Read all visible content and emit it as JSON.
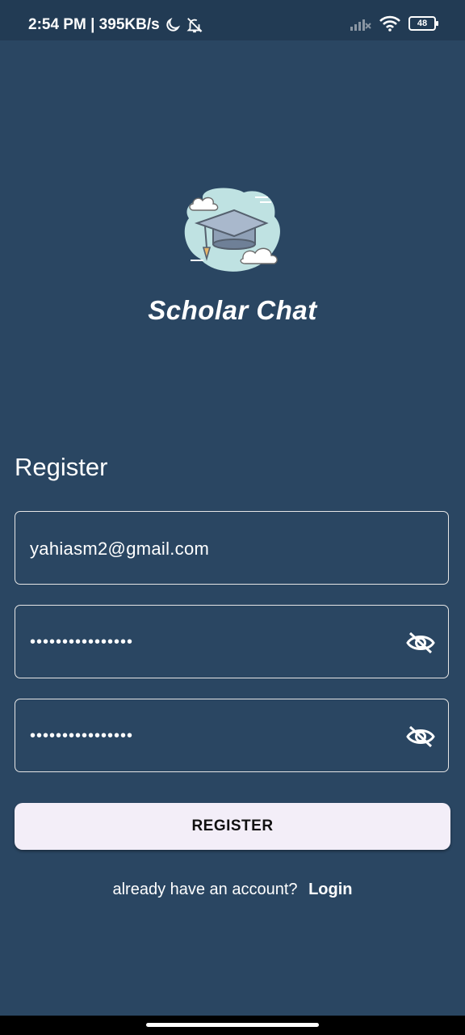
{
  "status_bar": {
    "time_speed": "2:54 PM | 395KB/s",
    "battery": "48"
  },
  "app": {
    "title": "Scholar Chat"
  },
  "form": {
    "heading": "Register",
    "email_value": "yahiasm2@gmail.com",
    "password_value": "••••••••••••••••",
    "confirm_password_value": "••••••••••••••••",
    "register_label": "REGISTER"
  },
  "footer": {
    "prompt": "already have an account?",
    "login_label": "Login"
  },
  "colors": {
    "background": "#2a4662",
    "status_bar": "#223b54",
    "button_bg": "#f3eef8"
  },
  "icons": [
    "moon-icon",
    "bell-off-icon",
    "signal-icon",
    "wifi-icon",
    "battery-icon",
    "graduation-cap-icon",
    "eye-off-icon"
  ]
}
